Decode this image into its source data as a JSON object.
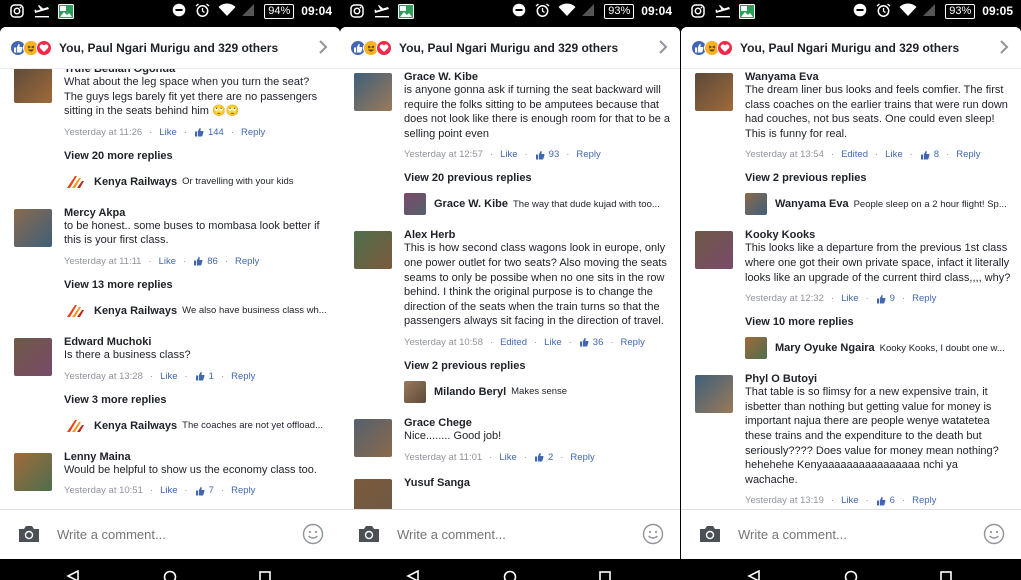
{
  "colors": {
    "brand": "#4267b2",
    "love": "#f0284a",
    "haha": "#f7b125"
  },
  "composer": {
    "placeholder": "Write a comment..."
  },
  "panels": [
    {
      "status": {
        "battery": "94%",
        "time": "09:04"
      },
      "reactions": {
        "summary": "You, Paul Ngari Murigu and 329 others"
      },
      "items": [
        {
          "kind": "comment",
          "name": "Trufe Beulah Ogonda",
          "text": "What about the leg space when you turn the seat? The guys legs barely fit yet there are no passengers sitting in the seats behind him 🙄🙄",
          "time": "Yesterday at 11:26",
          "edited": "",
          "like": "Like",
          "count": "144",
          "reply": "Reply"
        },
        {
          "kind": "more",
          "label": "View 20 more replies"
        },
        {
          "kind": "reply",
          "name": "Kenya Railways",
          "text": "Or travelling with your kids"
        },
        {
          "kind": "comment",
          "name": "Mercy Akpa",
          "text": "to be honest.. some buses to mombasa look better if this is your first class.",
          "time": "Yesterday at 11:11",
          "edited": "",
          "like": "Like",
          "count": "86",
          "reply": "Reply"
        },
        {
          "kind": "more",
          "label": "View 13 more replies"
        },
        {
          "kind": "reply",
          "name": "Kenya Railways",
          "text": "We also have business class wh..."
        },
        {
          "kind": "comment",
          "name": "Edward Muchoki",
          "text": "Is there a business class?",
          "time": "Yesterday at 13:28",
          "edited": "",
          "like": "Like",
          "count": "1",
          "reply": "Reply"
        },
        {
          "kind": "more",
          "label": "View 3 more replies"
        },
        {
          "kind": "reply",
          "name": "Kenya Railways",
          "text": "The coaches are not yet offload..."
        },
        {
          "kind": "comment",
          "name": "Lenny Maina",
          "text": "Would be helpful to show us the economy class too.",
          "time": "Yesterday at 10:51",
          "edited": "",
          "like": "Like",
          "count": "7",
          "reply": "Reply"
        }
      ]
    },
    {
      "status": {
        "battery": "93%",
        "time": "09:04"
      },
      "reactions": {
        "summary": "You, Paul Ngari Murigu and 329 others"
      },
      "items": [
        {
          "kind": "comment",
          "name": "Grace W. Kibe",
          "text": "is anyone gonna ask if turning the seat backward will require the folks sitting to be amputees because that does not look like there is enough room for that to be a selling point even",
          "time": "Yesterday at 12:57",
          "edited": "",
          "like": "Like",
          "count": "93",
          "reply": "Reply"
        },
        {
          "kind": "more",
          "label": "View 20 previous replies"
        },
        {
          "kind": "reply",
          "name": "Grace W. Kibe",
          "text": "The way that dude kujad with too..."
        },
        {
          "kind": "comment",
          "name": "Alex Herb",
          "text": "This is how second class wagons look in europe, only one power outlet for two seats? Also moving the seats seams to only be possibe when no one sits in the row behind. I think the original purpose is to change the direction of the seats when the train turns so that the passengers always sit facing in the direction of travel.",
          "time": "Yesterday at 10:58",
          "edited": "Edited",
          "like": "Like",
          "count": "36",
          "reply": "Reply"
        },
        {
          "kind": "more",
          "label": "View 2 previous replies"
        },
        {
          "kind": "reply",
          "name": "Milando Beryl",
          "text": "Makes sense"
        },
        {
          "kind": "comment",
          "name": "Grace Chege",
          "text": "Nice........ Good job!",
          "time": "Yesterday at 11:01",
          "edited": "",
          "like": "Like",
          "count": "2",
          "reply": "Reply"
        },
        {
          "kind": "comment",
          "name": "Yusuf Sanga",
          "text": "",
          "time": "",
          "edited": "",
          "like": "",
          "count": "",
          "reply": ""
        }
      ]
    },
    {
      "status": {
        "battery": "93%",
        "time": "09:05"
      },
      "reactions": {
        "summary": "You, Paul Ngari Murigu and 329 others"
      },
      "items": [
        {
          "kind": "comment",
          "name": "Wanyama Eva",
          "text": "The dream liner bus looks and feels comfier. The first class coaches on the earlier trains that were run down had couches, not  bus seats. One could even sleep! This is funny for real.",
          "time": "Yesterday at 13:54",
          "edited": "Edited",
          "like": "Like",
          "count": "8",
          "reply": "Reply"
        },
        {
          "kind": "more",
          "label": "View 2 previous replies"
        },
        {
          "kind": "reply",
          "name": "Wanyama Eva",
          "text": "People sleep on a 2 hour flight! Sp..."
        },
        {
          "kind": "comment",
          "name": "Kooky Kooks",
          "text": "This looks like a departure from the previous 1st class where one got their own private space, infact it literally looks like an upgrade of the current third class,,,, why?",
          "time": "Yesterday at 12:32",
          "edited": "",
          "like": "Like",
          "count": "9",
          "reply": "Reply"
        },
        {
          "kind": "more",
          "label": "View 10 more replies"
        },
        {
          "kind": "reply",
          "name": "Mary Oyuke Ngaira",
          "text": "Kooky Kooks, I doubt one w..."
        },
        {
          "kind": "comment",
          "name": "Phyl O Butoyi",
          "text": "That table is so flimsy for a new expensive train, it isbetter than nothing but getting value for money is important najua there are people wenye watatetea these trains and the expenditure to the death but seriously???? Does value for money mean nothing? hehehehe Kenyaaaaaaaaaaaaaaaa nchi ya wachache.",
          "time": "Yesterday at 13:19",
          "edited": "",
          "like": "Like",
          "count": "6",
          "reply": "Reply"
        }
      ]
    }
  ]
}
